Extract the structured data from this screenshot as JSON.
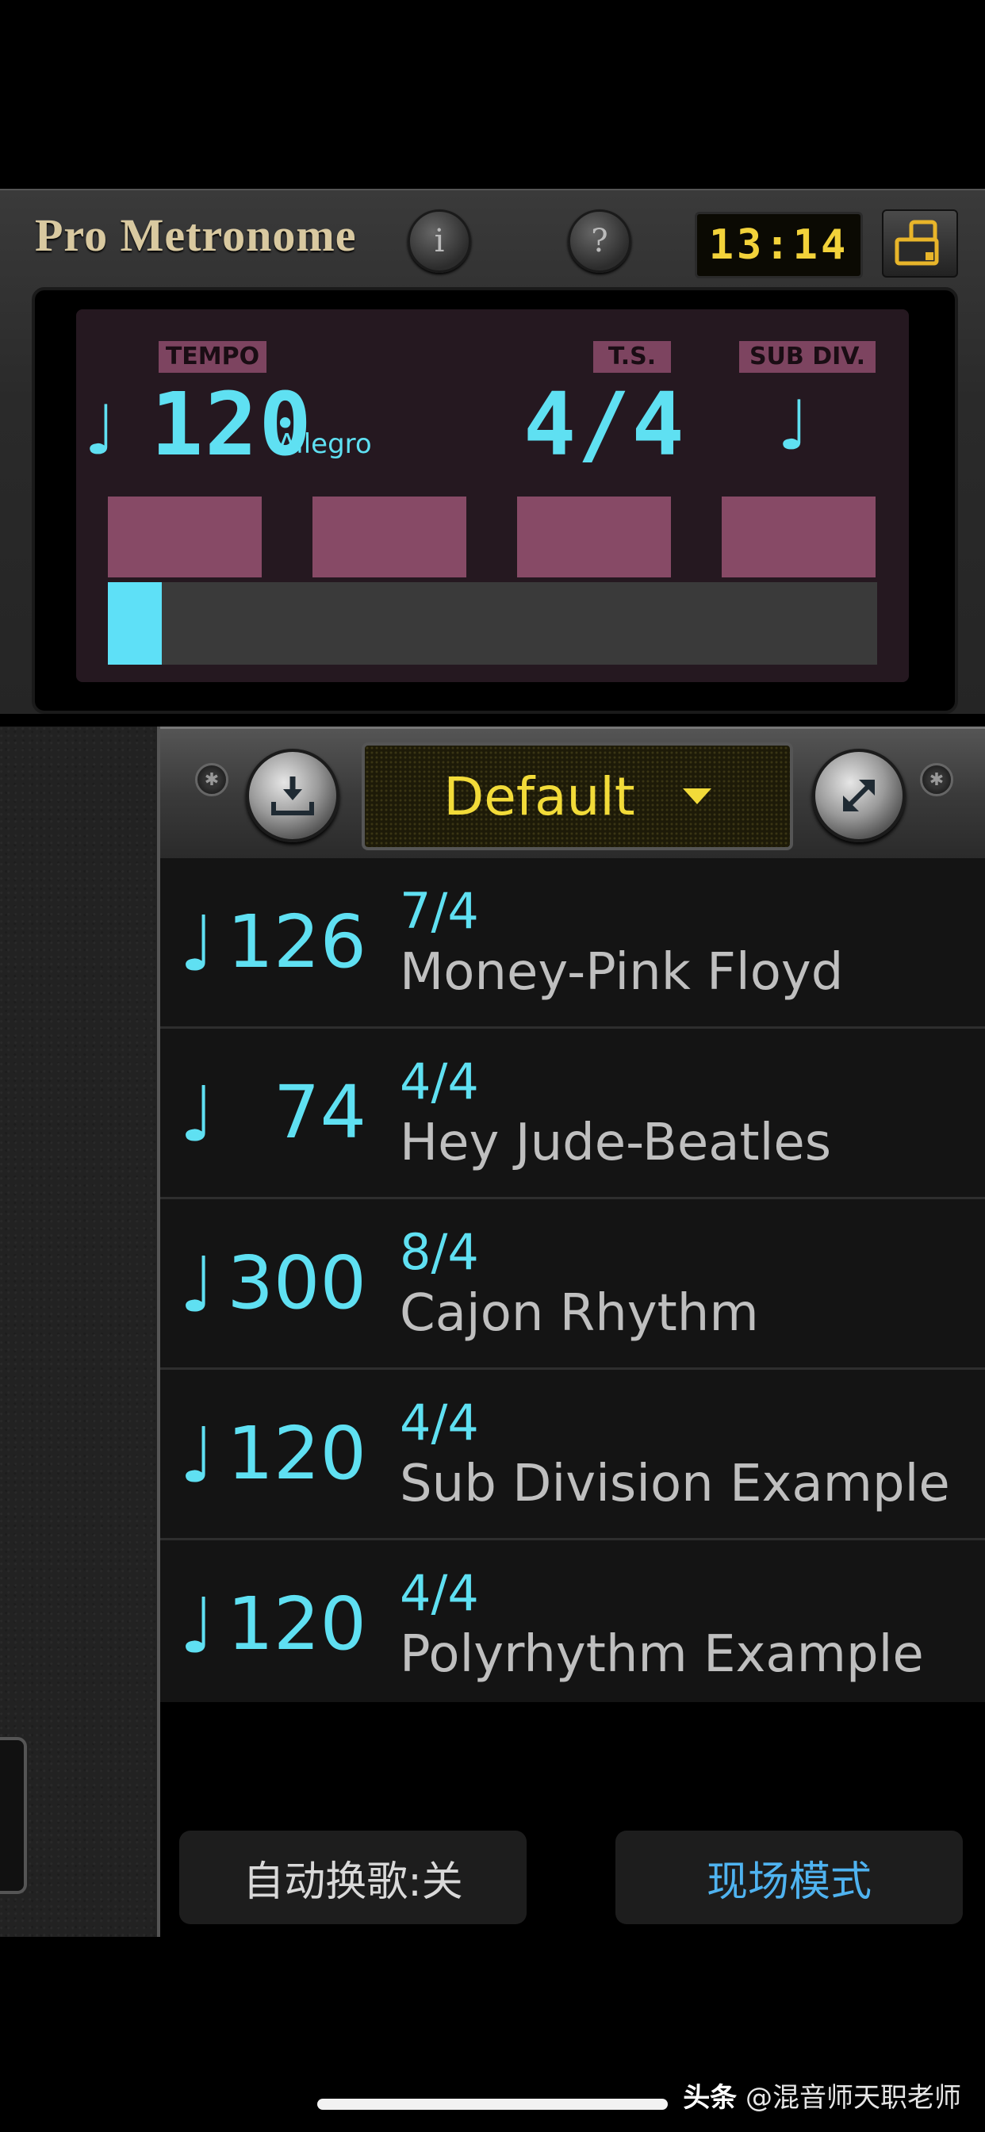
{
  "header": {
    "app_title": "Pro Metronome",
    "info_icon": "info-icon",
    "help_icon": "help-icon",
    "info_glyph": "i",
    "help_glyph": "?",
    "clock_time": "13:14",
    "layout_icon": "phone-tablet-layout-icon"
  },
  "display": {
    "tempo_tag": "TEMPO",
    "ts_tag": "T.S.",
    "subdiv_tag": "SUB DIV.",
    "tempo_note": "♩",
    "tempo_value": "120",
    "tempo_marking": "Allegro",
    "time_signature": "4/4",
    "subdivision_note": "♩",
    "beat_count": 4,
    "current_beat": 1,
    "beat_progress": 0.07,
    "colors": {
      "lcd": "#5fe0f2",
      "beat": "#874a66",
      "tag": "#7d4460"
    }
  },
  "controls": {
    "import_icon": "download-tray-icon",
    "expand_icon": "expand-arrows-icon",
    "preset_name": "Default",
    "preset_caret_icon": "caret-down-icon",
    "screw_glyph": "✱"
  },
  "songs": [
    {
      "note": "♩",
      "tempo": "126",
      "time_signature": "7/4",
      "name": "Money-Pink Floyd"
    },
    {
      "note": "♩",
      "tempo": "74",
      "time_signature": "4/4",
      "name": "Hey Jude-Beatles"
    },
    {
      "note": "♩",
      "tempo": "300",
      "time_signature": "8/4",
      "name": "Cajon Rhythm"
    },
    {
      "note": "♩",
      "tempo": "120",
      "time_signature": "4/4",
      "name": "Sub Division Example"
    },
    {
      "note": "♩",
      "tempo": "120",
      "time_signature": "4/4",
      "name": "Polyrhythm Example"
    }
  ],
  "bottom": {
    "auto_switch_label": "自动换歌:关",
    "live_mode_label": "现场模式",
    "colors": {
      "auto_switch": "#d9d9d9",
      "live_mode": "#4fb3f0"
    }
  },
  "footer": {
    "watermark_brand": "头条",
    "watermark_user": "@混音师天职老师"
  }
}
